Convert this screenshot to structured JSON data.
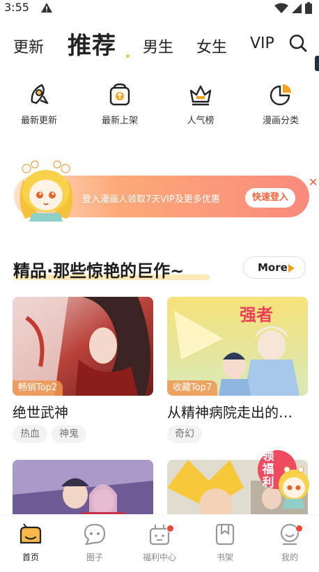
{
  "status": {
    "time": "3:55"
  },
  "nav": {
    "tabs": [
      {
        "label": "更新"
      },
      {
        "label": "推荐"
      },
      {
        "label": "男生"
      },
      {
        "label": "女生"
      },
      {
        "label": "VIP"
      }
    ],
    "active_tab": "推荐"
  },
  "quick_links": [
    {
      "label": "最新更新",
      "icon": "rocket-icon"
    },
    {
      "label": "最新上架",
      "icon": "upload-box-icon"
    },
    {
      "label": "人气榜",
      "icon": "crown-icon"
    },
    {
      "label": "漫画分类",
      "icon": "pie-chart-icon"
    }
  ],
  "banner": {
    "text": "登入漫画人领取7天VIP及更多优惠",
    "button": "快速登入"
  },
  "section": {
    "title": "精品·那些惊艳的巨作~",
    "more": "More"
  },
  "cards": [
    {
      "title": "绝世武神",
      "rank": "畅销Top2",
      "tags": [
        "热血",
        "神鬼"
      ]
    },
    {
      "title": "从精神病院走出的…",
      "rank": "收藏Top7",
      "tags": [
        "奇幻"
      ]
    }
  ],
  "cover_text": {
    "card2_title_art": "强者"
  },
  "float_badge": {
    "text": "领福利"
  },
  "bottom_nav": [
    {
      "label": "首页",
      "icon": "home-icon"
    },
    {
      "label": "圈子",
      "icon": "chat-icon"
    },
    {
      "label": "福利中心",
      "icon": "gift-icon"
    },
    {
      "label": "书架",
      "icon": "bookmark-icon"
    },
    {
      "label": "我的",
      "icon": "profile-icon"
    }
  ],
  "colors": {
    "accent": "#f7a21f",
    "banner_start": "#fde1c9",
    "banner_end": "#f98a7d",
    "badge_red": "#f0463a"
  }
}
